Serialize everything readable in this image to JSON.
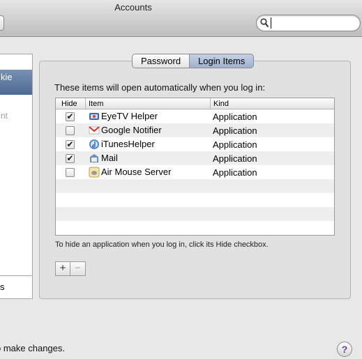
{
  "window": {
    "title": "Accounts"
  },
  "search": {
    "value": "",
    "placeholder": ""
  },
  "sidebar": {
    "selected_label": "kie",
    "sub_label": "nt",
    "bottom_label": "s"
  },
  "tabs": [
    {
      "label": "Password",
      "selected": false
    },
    {
      "label": "Login Items",
      "selected": true
    }
  ],
  "login_items": {
    "intro": "These items will open automatically when you log in:",
    "columns": {
      "hide": "Hide",
      "item": "Item",
      "kind": "Kind"
    },
    "rows": [
      {
        "hide": true,
        "item": "EyeTV Helper",
        "kind": "Application",
        "icon": "eyetv-icon"
      },
      {
        "hide": false,
        "item": "Google Notifier",
        "kind": "Application",
        "icon": "gmail-icon"
      },
      {
        "hide": true,
        "item": "iTunesHelper",
        "kind": "Application",
        "icon": "itunes-icon"
      },
      {
        "hide": true,
        "item": "Mail",
        "kind": "Application",
        "icon": "mail-icon"
      },
      {
        "hide": false,
        "item": "Air Mouse Server",
        "kind": "Application",
        "icon": "air-mouse-icon"
      }
    ],
    "note": "To hide an application when you log in, click its Hide checkbox.",
    "add_label": "+",
    "remove_label": "−"
  },
  "footer": {
    "lock_text": "o make changes.",
    "help_label": "?"
  },
  "colors": {
    "selection": "#5a76a0",
    "help_glyph": "#6a3fa0"
  }
}
